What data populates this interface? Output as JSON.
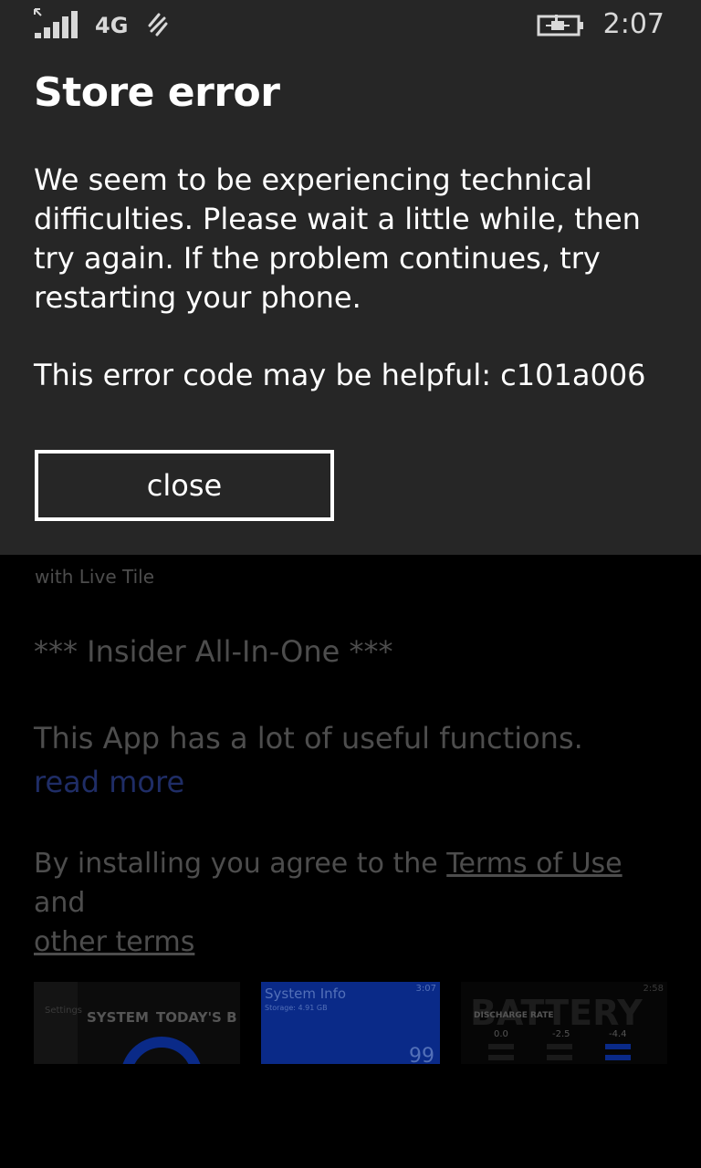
{
  "status_bar": {
    "network": "4G",
    "time": "2:07",
    "icons": [
      "signal-icon",
      "sync-icon",
      "battery-charging-icon"
    ]
  },
  "dialog": {
    "title": "Store error",
    "message": "We seem to be experiencing technical difficulties. Please wait a little while, then try again. If the problem continues, try restarting your phone.",
    "error_code_line": "This error code may be helpful: c101a006",
    "close_label": "close"
  },
  "background_page": {
    "live_tile_text": "with Live Tile",
    "insider_line": "*** Insider All-In-One ***",
    "description": "This App has a lot of useful functions.",
    "read_more": "read more",
    "terms": {
      "prefix": "By installing you agree to the ",
      "terms_link": "Terms of Use",
      "middle": " and",
      "other_link": "other terms"
    },
    "screenshots": [
      {
        "label_a": "SYSTEM",
        "label_b": "TODAY'S B",
        "side_label": "Settings"
      },
      {
        "title": "System Info",
        "subtitle": "Storage: 4.91 GB",
        "value": "99",
        "time": "3:07"
      },
      {
        "title": "BATTERY",
        "label": "DISCHARGE RATE",
        "time": "2:58",
        "v1": "0.0",
        "v2": "-2.5",
        "v3": "-4.4"
      }
    ]
  },
  "colors": {
    "dialog_bg": "#262626",
    "page_bg": "#000000",
    "dim_text": "#4d4d4d",
    "dim_link": "#1f2d66",
    "accent_blue": "#0a2a88"
  }
}
